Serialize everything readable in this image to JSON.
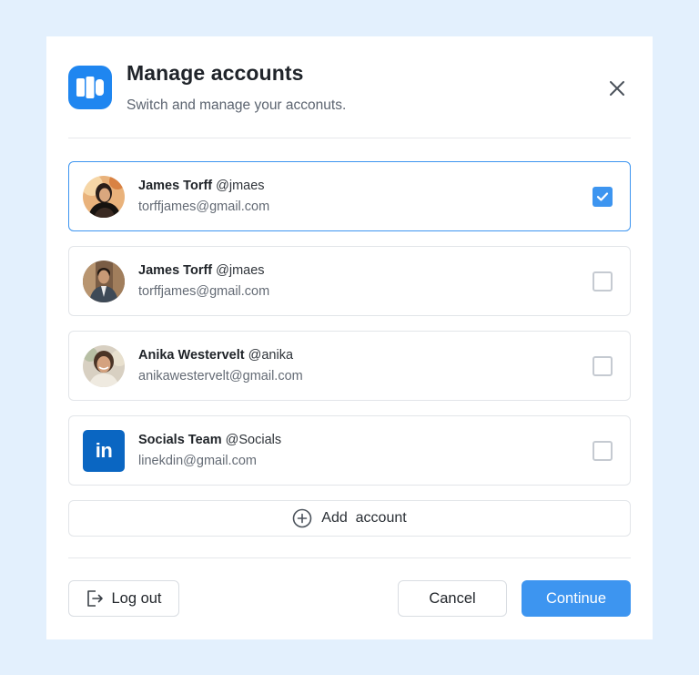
{
  "dialog": {
    "title": "Manage accounts",
    "subtitle": "Switch and manage your acconuts.",
    "app_icon": "app-logo-icon",
    "close_icon": "close-icon"
  },
  "accounts": [
    {
      "name": "James Torff",
      "handle": "@jmaes",
      "email": "torffjames@gmail.com",
      "avatar": "avatar-photo",
      "selected": true
    },
    {
      "name": "James Torff",
      "handle": "@jmaes",
      "email": "torffjames@gmail.com",
      "avatar": "avatar-photo",
      "selected": false
    },
    {
      "name": "Anika Westervelt",
      "handle": "@anika",
      "email": "anikawestervelt@gmail.com",
      "avatar": "avatar-photo",
      "selected": false
    },
    {
      "name": "Socials Team",
      "handle": "@Socials",
      "email": "linekdin@gmail.com",
      "avatar": "linkedin-logo",
      "logo_text": "in",
      "selected": false
    }
  ],
  "add_account": {
    "label": "Add  account",
    "icon": "plus-circle-icon"
  },
  "footer": {
    "logout_label": "Log out",
    "logout_icon": "logout-icon",
    "cancel_label": "Cancel",
    "continue_label": "Continue"
  },
  "colors": {
    "background": "#E3F0FD",
    "accent": "#3D95F0",
    "app_logo": "#1F86F0",
    "linkedin": "#0A66C2"
  }
}
